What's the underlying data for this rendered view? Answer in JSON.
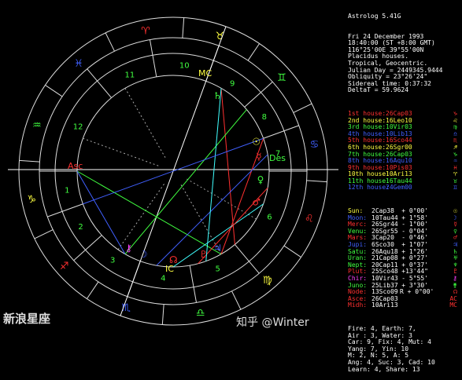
{
  "app": {
    "title": "Astrolog 5.41G"
  },
  "chart_info": [
    "Fri 24 December 1993",
    "18:40:00 (ST +8:00 GMT)",
    "116°25'00E 39°55'00N",
    "Placidus houses.",
    "Tropical, Geocentric.",
    "Julian Day = 2449345.9444",
    "Obliquity = 23°26'24\"",
    "Sidereal time: 0:37:32",
    "DeltaT = 59.9624"
  ],
  "houses": [
    {
      "label": "1st house:",
      "value": "26Cap03",
      "color": "#ff3030",
      "glyph": "♑"
    },
    {
      "label": "2nd house:",
      "value": "16Leo10",
      "color": "#ffff40",
      "glyph": "♌"
    },
    {
      "label": "3rd house:",
      "value": "10Vir03",
      "color": "#40ff40",
      "glyph": "♍"
    },
    {
      "label": "4th house:",
      "value": "10Lib13",
      "color": "#4060ff",
      "glyph": "♎"
    },
    {
      "label": "5th house:",
      "value": "16Sco44",
      "color": "#ff3030",
      "glyph": "♏"
    },
    {
      "label": "6th house:",
      "value": "26Sgr00",
      "color": "#ffff40",
      "glyph": "♐"
    },
    {
      "label": "7th house:",
      "value": "26Cap03",
      "color": "#40ff40",
      "glyph": "♑"
    },
    {
      "label": "8th house:",
      "value": "16Aqu10",
      "color": "#4060ff",
      "glyph": "♒"
    },
    {
      "label": "9th house:",
      "value": "10Pis03",
      "color": "#ff3030",
      "glyph": "♓"
    },
    {
      "label": "10th house:",
      "value": "10Ari13",
      "color": "#ffff40",
      "glyph": "♈"
    },
    {
      "label": "11th house:",
      "value": "16Tau44",
      "color": "#40ff40",
      "glyph": "♉"
    },
    {
      "label": "12th house:",
      "value": "24Gem00",
      "color": "#4060ff",
      "glyph": "♊"
    }
  ],
  "planets": [
    {
      "name": "Sun:",
      "pos": "2Cap38",
      "speed": "+ 0°00'",
      "color": "#ffff40",
      "glyph": "☉"
    },
    {
      "name": "Moon:",
      "pos": "10Tau44",
      "speed": "+ 1°58'",
      "color": "#4060ff",
      "glyph": "☽"
    },
    {
      "name": "Merc:",
      "pos": "26Sgr44",
      "speed": "- 1°00'",
      "color": "#ff3030",
      "glyph": "☿"
    },
    {
      "name": "Venu:",
      "pos": "26Sgr55",
      "speed": "- 0°04'",
      "color": "#40ff40",
      "glyph": "♀"
    },
    {
      "name": "Mars:",
      "pos": "3Cap20",
      "speed": "- 0°46'",
      "color": "#ff3030",
      "glyph": "♂"
    },
    {
      "name": "Jupi:",
      "pos": "6Sco30",
      "speed": "+ 1°07'",
      "color": "#4060ff",
      "glyph": "♃"
    },
    {
      "name": "Satu:",
      "pos": "26Aqu18",
      "speed": "+ 1°26'",
      "color": "#40ff40",
      "glyph": "♄"
    },
    {
      "name": "Uran:",
      "pos": "21Cap08",
      "speed": "+ 0°27'",
      "color": "#40ff40",
      "glyph": "♅"
    },
    {
      "name": "Nept:",
      "pos": "20Cap11",
      "speed": "+ 0°37'",
      "color": "#40ff40",
      "glyph": "♆"
    },
    {
      "name": "Plut:",
      "pos": "25Sco48",
      "speed": "+13'44\"",
      "color": "#ff3030",
      "glyph": "♇"
    },
    {
      "name": "Chir:",
      "pos": "10Vir43",
      "speed": "- 5°55'",
      "color": "#ff40ff",
      "glyph": "⚷"
    },
    {
      "name": "Juno:",
      "pos": "25Lib37",
      "speed": "+ 3°30'",
      "color": "#40ff40",
      "glyph": "⚵"
    },
    {
      "name": "Node:",
      "pos": "13Sco09",
      "speed": "R + 0°00'",
      "color": "#ff3030",
      "glyph": "☊"
    },
    {
      "name": "Asce:",
      "pos": "26Cap03",
      "speed": "",
      "color": "#ff3030",
      "glyph": "AC"
    },
    {
      "name": "Midh:",
      "pos": "10Ari13",
      "speed": "",
      "color": "#ff3030",
      "glyph": "MC"
    }
  ],
  "summary": [
    "Fire: 4, Earth: 7,",
    "Air : 3, Water: 3",
    "Car: 9, Fix: 4, Mut: 4",
    "Yang: 7, Yin: 10",
    "M: 2, N: 5, A: 5",
    "Ang: 4, Suc: 3, Cad: 10",
    "Learn: 4, Share: 13"
  ],
  "wheel": {
    "house_numbers": [
      "1",
      "2",
      "3",
      "4",
      "5",
      "6",
      "7",
      "8",
      "9",
      "10",
      "11",
      "12"
    ],
    "asc_label": "Asc",
    "desc_label": "Des",
    "mc_label": "MC",
    "ic_label": "IC"
  },
  "watermark": {
    "left": "新浪星座",
    "right": "知乎 @Winter"
  },
  "colors": {
    "fire": "#ff3030",
    "earth": "#ffff40",
    "air": "#40ff40",
    "water": "#4060ff",
    "aspect_square": "#ff3030",
    "aspect_trine": "#40ff40",
    "aspect_sextile": "#4060ff",
    "aspect_minor": "#40ffff"
  }
}
